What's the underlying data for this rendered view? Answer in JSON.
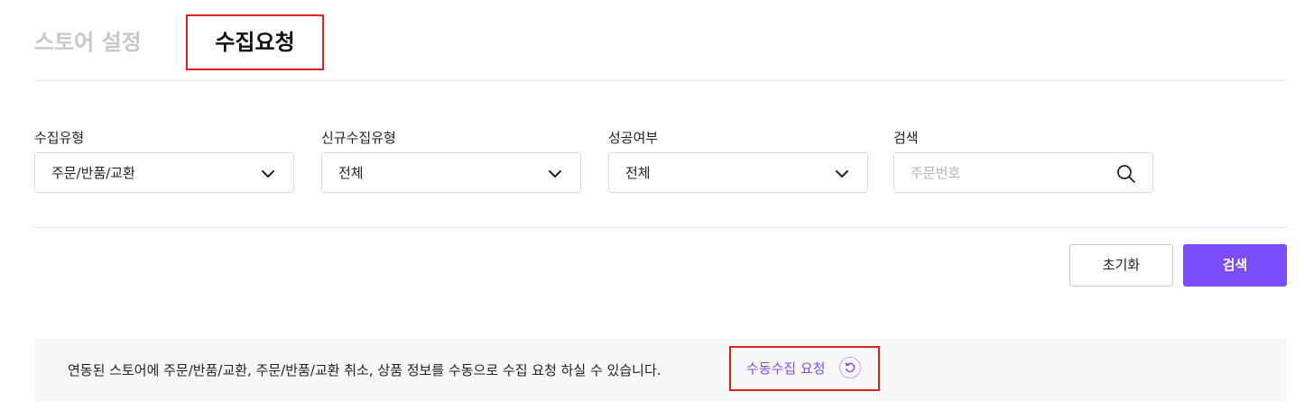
{
  "tabs": [
    {
      "label": "스토어 설정",
      "active": false
    },
    {
      "label": "수집요청",
      "active": true
    }
  ],
  "filters": {
    "collect_type": {
      "label": "수집유형",
      "value": "주문/반품/교환"
    },
    "new_collect_type": {
      "label": "신규수집유형",
      "value": "전체"
    },
    "success": {
      "label": "성공여부",
      "value": "전체"
    },
    "search": {
      "label": "검색",
      "placeholder": "주문번호",
      "value": ""
    }
  },
  "buttons": {
    "reset": "초기화",
    "search": "검색"
  },
  "info": {
    "text": "연동된 스토어에 주문/반품/교환, 주문/반품/교환 취소, 상품 정보를 수동으로 수집 요청 하실 수 있습니다.",
    "manual_link": "수동수집 요청"
  },
  "icons": {
    "chevron": "chevron-down-icon",
    "search": "search-icon",
    "refresh": "refresh-icon"
  },
  "colors": {
    "accent": "#7b4dff",
    "highlight_border": "#e02020",
    "inactive_tab": "#c8c8c8",
    "info_background": "#f7f7f7"
  }
}
